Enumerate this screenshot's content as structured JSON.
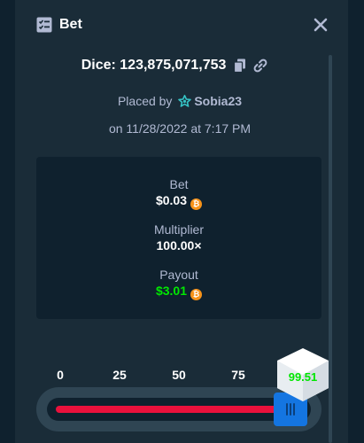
{
  "header": {
    "title": "Bet",
    "icon": "bet-receipt-icon",
    "close_icon": "close-icon"
  },
  "game": {
    "label": "Dice: 123,875,071,753",
    "copy_icon": "copy-icon",
    "link_icon": "link-icon"
  },
  "placed_by": {
    "prefix": "Placed by",
    "username": "Sobia23",
    "vip_icon": "vip-badge-icon"
  },
  "date": "on 11/28/2022 at 7:17 PM",
  "stats": {
    "bet_label": "Bet",
    "bet_value": "$0.03",
    "multiplier_label": "Multiplier",
    "multiplier_value": "100.00×",
    "payout_label": "Payout",
    "payout_value": "$3.01",
    "coin_icon": "bitcoin-icon"
  },
  "slider": {
    "ticks": [
      "0",
      "25",
      "50",
      "75"
    ],
    "roll_over_target": 99.01,
    "result": "99.51",
    "colors": {
      "lose": "#e9113c",
      "win": "#00e701",
      "handle": "#1475e1"
    }
  }
}
